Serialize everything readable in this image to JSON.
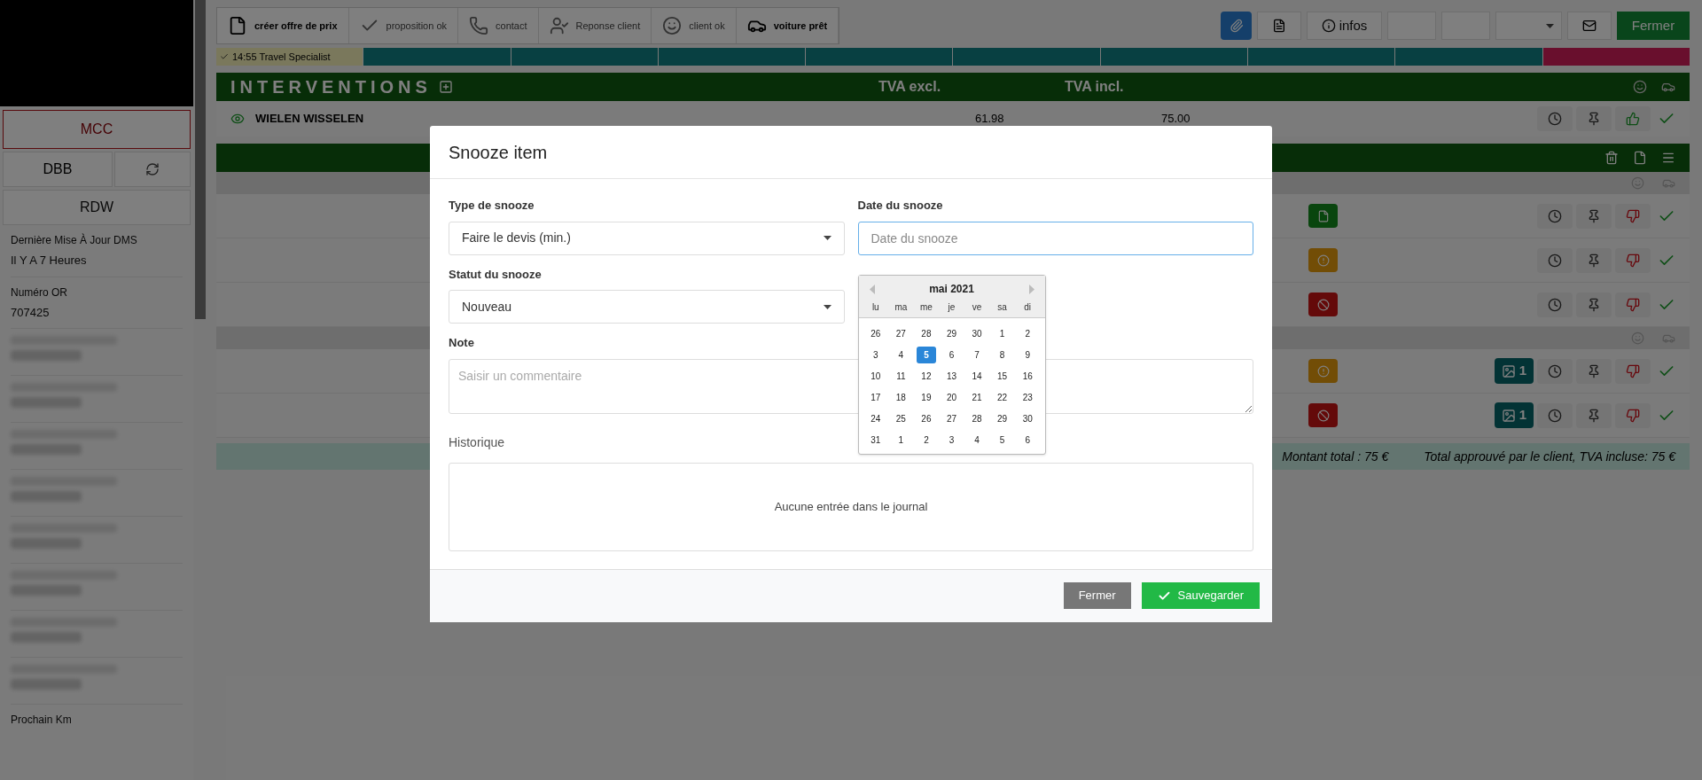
{
  "sidebar": {
    "mcc": "MCC",
    "dbb": "DBB",
    "rdw": "RDW",
    "fields": [
      {
        "label": "Dernière Mise À Jour DMS",
        "value": "Il Y A 7 Heures"
      },
      {
        "label": "Numéro OR",
        "value": "707425"
      }
    ],
    "bottom_label": "Prochain Km"
  },
  "steps": [
    {
      "label": "créer offre de prix",
      "kind": "file",
      "active": true
    },
    {
      "label": "proposition ok",
      "kind": "check",
      "active": false
    },
    {
      "label": "contact",
      "kind": "phone",
      "active": false
    },
    {
      "label": "Reponse client",
      "kind": "user",
      "active": false
    },
    {
      "label": "client ok",
      "kind": "smile",
      "active": false
    },
    {
      "label": "voiture prêt",
      "kind": "car",
      "active": true
    }
  ],
  "toolbar_right": {
    "infos": "infos",
    "close": "Fermer"
  },
  "timeline": [
    {
      "label": "14:55 Travel Specialist",
      "color": "#7a785c"
    },
    {
      "color": "#084042"
    },
    {
      "color": "#084042"
    },
    {
      "color": "#084042"
    },
    {
      "color": "#084042"
    },
    {
      "color": "#084042"
    },
    {
      "color": "#084042"
    },
    {
      "color": "#084042"
    },
    {
      "color": "#084042"
    },
    {
      "color": "#690f2d"
    }
  ],
  "interventions": {
    "title": "INTERVENTIONS",
    "columns": [
      "TVA excl.",
      "TVA incl."
    ],
    "rows": [
      {
        "name": "WIELEN WISSELEN",
        "excl": "61.98",
        "incl": "75.00",
        "approved": true
      }
    ]
  },
  "items": [
    {
      "kind": "group"
    },
    {
      "kind": "document"
    },
    {
      "kind": "warning"
    },
    {
      "kind": "blocked"
    },
    {
      "kind": "group"
    },
    {
      "kind": "warning",
      "photos": "1"
    },
    {
      "kind": "blocked",
      "photos": "1"
    }
  ],
  "totals": {
    "total": "Montant total : 75 €",
    "approved": "Total approuvé par le client, TVA incluse: 75 €"
  },
  "modal": {
    "title": "Snooze item",
    "type_label": "Type de snooze",
    "type_value": "Faire le devis (min.)",
    "status_label": "Statut du snooze",
    "status_value": "Nouveau",
    "date_label": "Date du snooze",
    "date_placeholder": "Date du snooze",
    "note_label": "Note",
    "note_placeholder": "Saisir un commentaire",
    "history_label": "Historique",
    "history_empty": "Aucune entrée dans le journal",
    "cancel": "Fermer",
    "save": "Sauvegarder"
  },
  "calendar": {
    "month": "mai 2021",
    "weekdays": [
      "lu",
      "ma",
      "me",
      "je",
      "ve",
      "sa",
      "di"
    ],
    "weeks": [
      [
        {
          "day": "26",
          "selected": false
        },
        {
          "day": "27",
          "selected": false
        },
        {
          "day": "28",
          "selected": false
        },
        {
          "day": "29",
          "selected": false
        },
        {
          "day": "30",
          "selected": false
        },
        {
          "day": "1",
          "selected": false
        },
        {
          "day": "2",
          "selected": false
        }
      ],
      [
        {
          "day": "3",
          "selected": false
        },
        {
          "day": "4",
          "selected": false
        },
        {
          "day": "5",
          "selected": true
        },
        {
          "day": "6",
          "selected": false
        },
        {
          "day": "7",
          "selected": false
        },
        {
          "day": "8",
          "selected": false
        },
        {
          "day": "9",
          "selected": false
        }
      ],
      [
        {
          "day": "10",
          "selected": false
        },
        {
          "day": "11",
          "selected": false
        },
        {
          "day": "12",
          "selected": false
        },
        {
          "day": "13",
          "selected": false
        },
        {
          "day": "14",
          "selected": false
        },
        {
          "day": "15",
          "selected": false
        },
        {
          "day": "16",
          "selected": false
        }
      ],
      [
        {
          "day": "17",
          "selected": false
        },
        {
          "day": "18",
          "selected": false
        },
        {
          "day": "19",
          "selected": false
        },
        {
          "day": "20",
          "selected": false
        },
        {
          "day": "21",
          "selected": false
        },
        {
          "day": "22",
          "selected": false
        },
        {
          "day": "23",
          "selected": false
        }
      ],
      [
        {
          "day": "24",
          "selected": false
        },
        {
          "day": "25",
          "selected": false
        },
        {
          "day": "26",
          "selected": false
        },
        {
          "day": "27",
          "selected": false
        },
        {
          "day": "28",
          "selected": false
        },
        {
          "day": "29",
          "selected": false
        },
        {
          "day": "30",
          "selected": false
        }
      ],
      [
        {
          "day": "31",
          "selected": false
        },
        {
          "day": "1",
          "selected": false
        },
        {
          "day": "2",
          "selected": false
        },
        {
          "day": "3",
          "selected": false
        },
        {
          "day": "4",
          "selected": false
        },
        {
          "day": "5",
          "selected": false
        },
        {
          "day": "6",
          "selected": false
        }
      ]
    ]
  }
}
